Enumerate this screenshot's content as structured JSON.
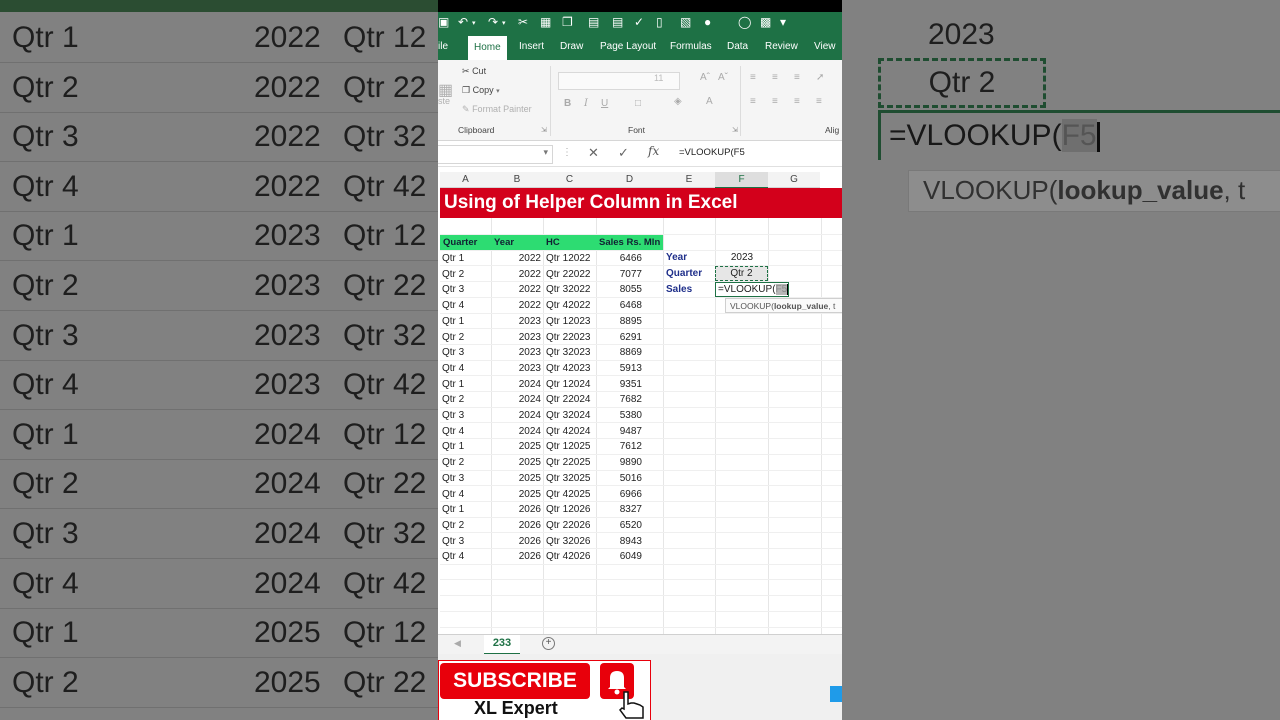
{
  "app": {
    "tabs": [
      "ile",
      "Home",
      "Insert",
      "Draw",
      "Page Layout",
      "Formulas",
      "Data",
      "Review",
      "View"
    ],
    "active_tab": "Home"
  },
  "ribbon": {
    "cut": "Cut",
    "copy": "Copy",
    "format_painter": "Format Painter",
    "paste_partial": "ste",
    "font_size": "11",
    "clipboard_group": "Clipboard",
    "font_group": "Font",
    "align_group": "Alig"
  },
  "formula_bar": {
    "content": "=VLOOKUP(F5"
  },
  "columns": [
    "A",
    "B",
    "C",
    "D",
    "E",
    "F",
    "G"
  ],
  "banner": "Using of Helper Column in Excel",
  "table": {
    "headers": [
      "Quarter",
      "Year",
      "HC",
      "Sales Rs. Mln"
    ],
    "rows": [
      [
        "Qtr 1",
        "2022",
        "Qtr 12022",
        "6466"
      ],
      [
        "Qtr 2",
        "2022",
        "Qtr 22022",
        "7077"
      ],
      [
        "Qtr 3",
        "2022",
        "Qtr 32022",
        "8055"
      ],
      [
        "Qtr 4",
        "2022",
        "Qtr 42022",
        "6468"
      ],
      [
        "Qtr 1",
        "2023",
        "Qtr 12023",
        "8895"
      ],
      [
        "Qtr 2",
        "2023",
        "Qtr 22023",
        "6291"
      ],
      [
        "Qtr 3",
        "2023",
        "Qtr 32023",
        "8869"
      ],
      [
        "Qtr 4",
        "2023",
        "Qtr 42023",
        "5913"
      ],
      [
        "Qtr 1",
        "2024",
        "Qtr 12024",
        "9351"
      ],
      [
        "Qtr 2",
        "2024",
        "Qtr 22024",
        "7682"
      ],
      [
        "Qtr 3",
        "2024",
        "Qtr 32024",
        "5380"
      ],
      [
        "Qtr 4",
        "2024",
        "Qtr 42024",
        "9487"
      ],
      [
        "Qtr 1",
        "2025",
        "Qtr 12025",
        "7612"
      ],
      [
        "Qtr 2",
        "2025",
        "Qtr 22025",
        "9890"
      ],
      [
        "Qtr 3",
        "2025",
        "Qtr 32025",
        "5016"
      ],
      [
        "Qtr 4",
        "2025",
        "Qtr 42025",
        "6966"
      ],
      [
        "Qtr 1",
        "2026",
        "Qtr 12026",
        "8327"
      ],
      [
        "Qtr 2",
        "2026",
        "Qtr 22026",
        "6520"
      ],
      [
        "Qtr 3",
        "2026",
        "Qtr 32026",
        "8943"
      ],
      [
        "Qtr 4",
        "2026",
        "Qtr 42026",
        "6049"
      ]
    ]
  },
  "lookup": {
    "year_label": "Year",
    "year_value": "2023",
    "quarter_label": "Quarter",
    "quarter_value": "Qtr 2",
    "sales_label": "Sales",
    "formula_prefix": "=VLOOKUP(",
    "formula_ref": "F5",
    "tooltip_fn": "VLOOKUP(",
    "tooltip_arg": "lookup_value",
    "tooltip_rest": ", t"
  },
  "sheet": {
    "name": "233",
    "add": "+"
  },
  "promo": {
    "subscribe": "SUBSCRIBE",
    "brand": "XL Expert"
  },
  "background_zoom": {
    "left_rows": [
      [
        "Qtr 1",
        "2022",
        "Qtr 12"
      ],
      [
        "Qtr 2",
        "2022",
        "Qtr 22"
      ],
      [
        "Qtr 3",
        "2022",
        "Qtr 32"
      ],
      [
        "Qtr 4",
        "2022",
        "Qtr 42"
      ],
      [
        "Qtr 1",
        "2023",
        "Qtr 12"
      ],
      [
        "Qtr 2",
        "2023",
        "Qtr 22"
      ],
      [
        "Qtr 3",
        "2023",
        "Qtr 32"
      ],
      [
        "Qtr 4",
        "2023",
        "Qtr 42"
      ],
      [
        "Qtr 1",
        "2024",
        "Qtr 12"
      ],
      [
        "Qtr 2",
        "2024",
        "Qtr 22"
      ],
      [
        "Qtr 3",
        "2024",
        "Qtr 32"
      ],
      [
        "Qtr 4",
        "2024",
        "Qtr 42"
      ],
      [
        "Qtr 1",
        "2025",
        "Qtr 12"
      ],
      [
        "Qtr 2",
        "2025",
        "Qtr 22"
      ]
    ],
    "right_year": "2023",
    "right_quarter": "Qtr 2",
    "right_formula_prefix": "=VLOOKUP(",
    "right_formula_ref": "F5",
    "right_tooltip_fn": "VLOOKUP(",
    "right_tooltip_arg": "lookup_value",
    "right_tooltip_rest": ", t"
  },
  "colors": {
    "excel_green": "#1e7145",
    "banner_red": "#d3001b",
    "header_green": "#2ddc72",
    "label_blue": "#1f2f8a",
    "subscribe_red": "#e8000b"
  },
  "icons": [
    "save-icon",
    "undo-icon",
    "redo-icon",
    "scissors-icon",
    "copy-icon",
    "format-painter-icon",
    "cancel-icon",
    "enter-check-icon",
    "bell-icon",
    "hand-cursor-icon",
    "windows-icon"
  ]
}
